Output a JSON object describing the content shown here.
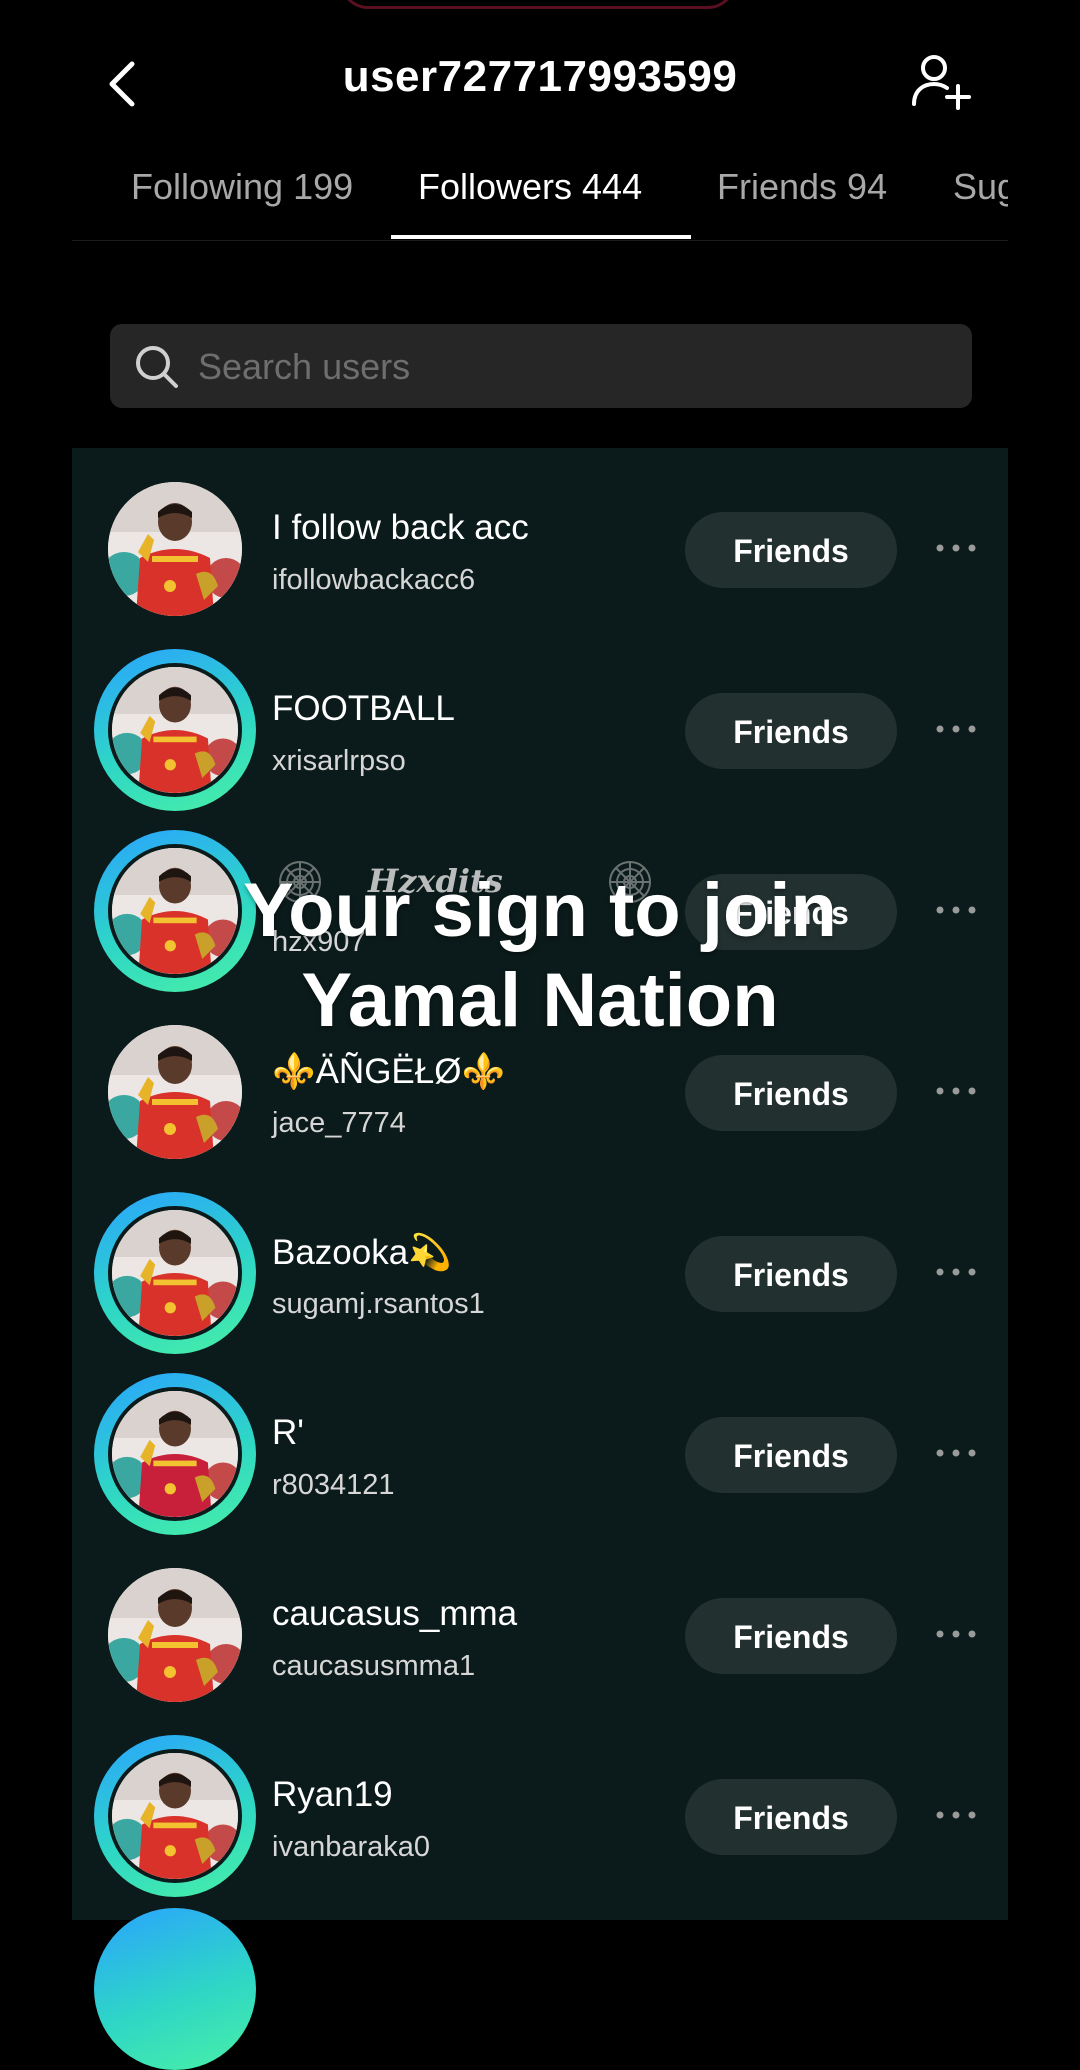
{
  "header": {
    "title": "user727717993599"
  },
  "tabs": [
    {
      "label": "Following 199"
    },
    {
      "label": "Followers 444"
    },
    {
      "label": "Friends 94"
    },
    {
      "label": "Sug"
    }
  ],
  "active_tab": "Followers 444",
  "search": {
    "placeholder": "Search users",
    "value": ""
  },
  "overlay": {
    "line1": "Your sign to join",
    "line2": "Yamal Nation",
    "watermark": "Hzxdits"
  },
  "follow_button_label": "Friends",
  "users": [
    {
      "name": "I follow back acc",
      "handle": "ifollowbackacc6",
      "story_ring": false,
      "button": "Friends"
    },
    {
      "name": "FOOTBALL",
      "handle": "xrisarlrpso",
      "story_ring": true,
      "button": "Friends"
    },
    {
      "name": "",
      "handle": "hzx907",
      "story_ring": true,
      "button": "Friends"
    },
    {
      "name": "⚜️ÄÑGËŁØ⚜️",
      "handle": "jace_7774",
      "story_ring": false,
      "button": "Friends"
    },
    {
      "name": "Bazooka💫",
      "handle": "sugamj.rsantos1",
      "story_ring": true,
      "button": "Friends"
    },
    {
      "name": "R'",
      "handle": "r8034121",
      "story_ring": true,
      "button": "Friends"
    },
    {
      "name": "caucasus_mma",
      "handle": "caucasusmma1",
      "story_ring": false,
      "button": "Friends"
    },
    {
      "name": "Ryan19",
      "handle": "ivanbaraka0",
      "story_ring": true,
      "button": "Friends"
    }
  ],
  "colors": {
    "background": "#000000",
    "list_background": "#0b1a1a",
    "button_background": "#22302f",
    "story_ring_start": "#2aa3ff",
    "story_ring_end": "#49f0a6"
  }
}
